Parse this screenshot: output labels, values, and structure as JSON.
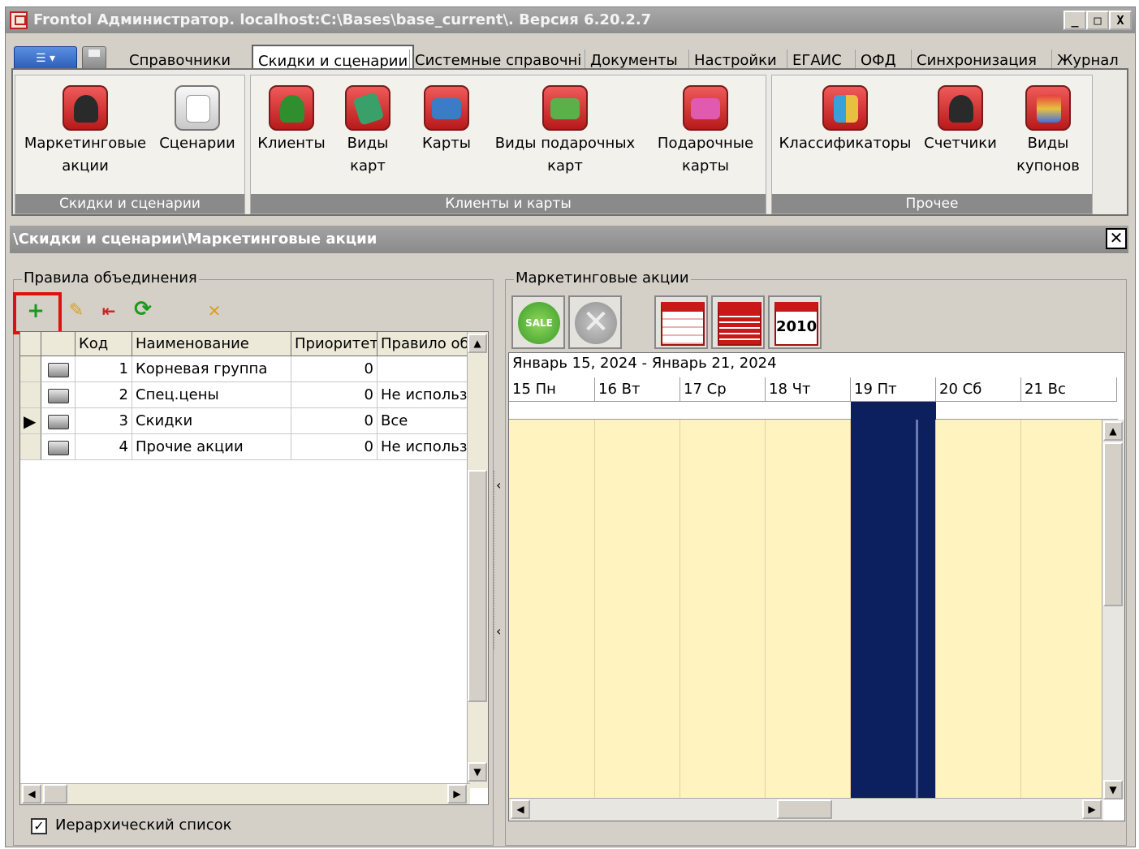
{
  "window": {
    "title": "Frontol Администратор. localhost:C:\\Bases\\base_current\\. Версия 6.20.2.7",
    "controls": [
      "_",
      "□",
      "X"
    ]
  },
  "menu_tabs": [
    "Справочники",
    "Скидки и сценарии",
    "Системные справочні",
    "Документы",
    "Настройки",
    "ЕГАИС",
    "ОФД",
    "Синхронизация",
    "Журнал"
  ],
  "active_tab": "Скидки и сценарии",
  "ribbon": {
    "groups": [
      {
        "label": "Скидки и сценарии",
        "buttons": [
          {
            "line1": "Маркетинговые",
            "line2": "акции",
            "icon": "graduate-icon"
          },
          {
            "line1": "Сценарии",
            "line2": "",
            "icon": "documents-icon"
          }
        ]
      },
      {
        "label": "Клиенты и карты",
        "buttons": [
          {
            "line1": "Клиенты",
            "line2": "",
            "icon": "client-icon"
          },
          {
            "line1": "Виды",
            "line2": "карт",
            "icon": "card-types-icon"
          },
          {
            "line1": "Карты",
            "line2": "",
            "icon": "card-icon"
          },
          {
            "line1": "Виды подарочных",
            "line2": "карт",
            "icon": "gift-card-types-icon"
          },
          {
            "line1": "Подарочные",
            "line2": "карты",
            "icon": "gift-card-icon"
          }
        ]
      },
      {
        "label": "Прочее",
        "buttons": [
          {
            "line1": "Классификаторы",
            "line2": "",
            "icon": "classifier-icon"
          },
          {
            "line1": "Счетчики",
            "line2": "",
            "icon": "counter-icon"
          },
          {
            "line1": "Виды",
            "line2": "купонов",
            "icon": "coupon-icon"
          }
        ]
      }
    ]
  },
  "breadcrumb": "\\Скидки и сценарии\\Маркетинговые акции",
  "left_panel": {
    "legend": "Правила объединения",
    "columns": [
      "Код",
      "Наименование",
      "Приоритет",
      "Правило об"
    ],
    "rows": [
      {
        "code": "1",
        "name": "Корневая группа",
        "priority": "0",
        "rule": ""
      },
      {
        "code": "2",
        "name": "Спец.цены",
        "priority": "0",
        "rule": "Не использ"
      },
      {
        "code": "3",
        "name": "Скидки",
        "priority": "0",
        "rule": "Все"
      },
      {
        "code": "4",
        "name": "Прочие акции",
        "priority": "0",
        "rule": "Не использ"
      }
    ],
    "selected_row": 3,
    "hierarchical_label": "Иерархический список",
    "hierarchical_checked": true
  },
  "right_panel": {
    "legend": "Маркетинговые акции",
    "year_button": "2010",
    "sale_badge": "SALE",
    "date_range": "Январь 15, 2024 - Январь 21, 2024",
    "days": [
      "15 Пн",
      "16 Вт",
      "17 Ср",
      "18 Чт",
      "19 Пт",
      "20 Сб",
      "21 Вс"
    ],
    "highlighted_day": "19 Пт"
  },
  "colors": {
    "highlight": "#e01010",
    "calendar_bg": "#fff3c0",
    "selected_day": "#0c2060"
  }
}
